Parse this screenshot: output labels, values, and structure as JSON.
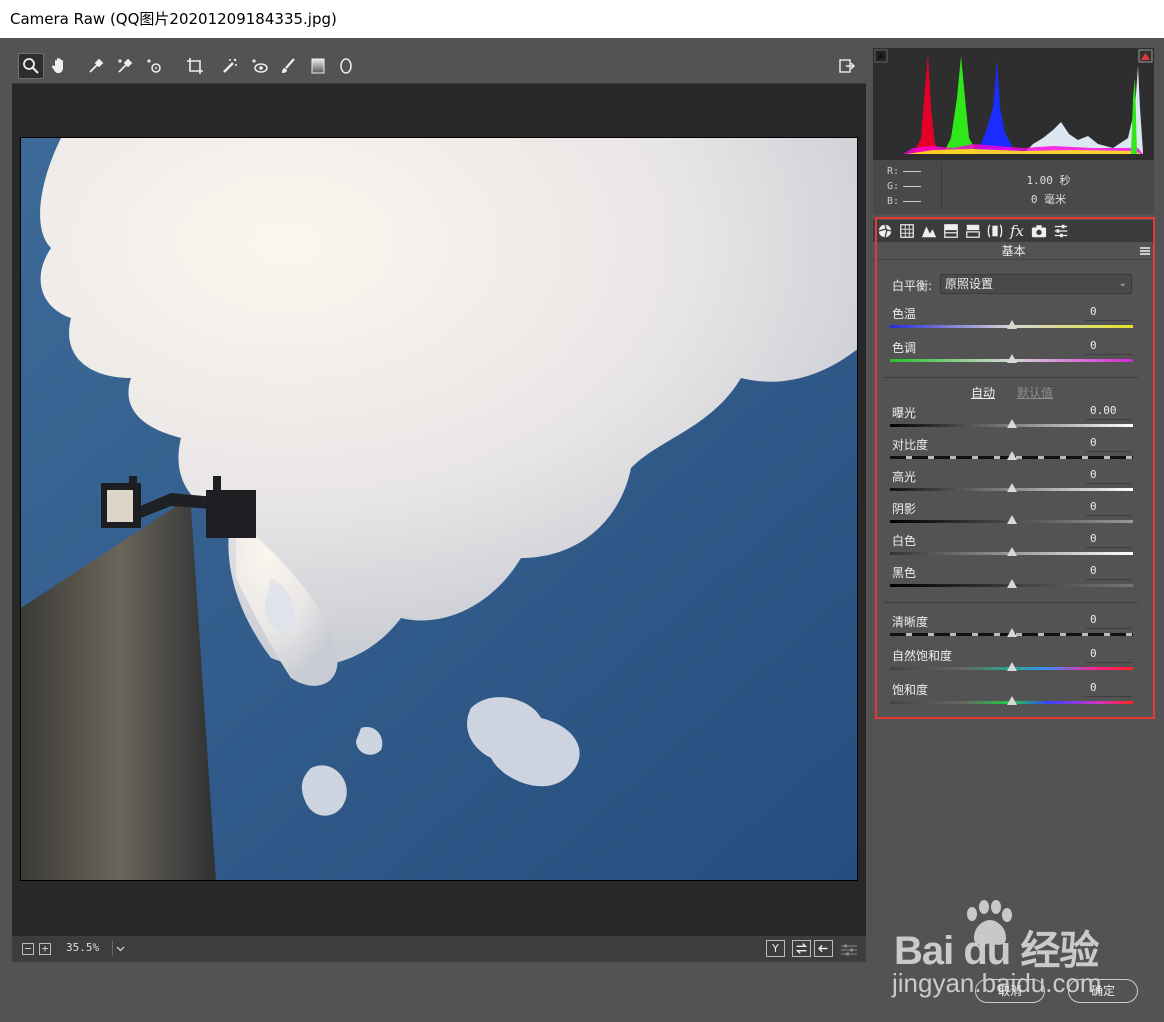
{
  "window": {
    "title": "Camera Raw (QQ图片20201209184335.jpg)"
  },
  "toolbar": {
    "tools": [
      "zoom-icon",
      "hand-icon",
      "eyedropper-icon",
      "color-sampler-icon",
      "targeted-adjust-icon",
      "crop-icon",
      "spot-removal-icon",
      "red-eye-icon",
      "adjustment-brush-icon",
      "graduated-filter-icon",
      "radial-filter-icon"
    ]
  },
  "status": {
    "zoom": "35.5%",
    "minus": "−",
    "plus": "+",
    "compare_label": "Y"
  },
  "histogram": {
    "r_label": "R:",
    "g_label": "G:",
    "b_label": "B:",
    "shutter": "1.00 秒",
    "focal": "0 毫米"
  },
  "panel": {
    "title": "基本",
    "white_balance_label": "白平衡:",
    "white_balance_value": "原照设置",
    "auto_label": "自动",
    "default_label": "默认值",
    "sliders": [
      {
        "label": "色温",
        "value": "0",
        "position": 0.5
      },
      {
        "label": "色调",
        "value": "0",
        "position": 0.5
      },
      {
        "label": "曝光",
        "value": "0.00",
        "position": 0.5
      },
      {
        "label": "对比度",
        "value": "0",
        "position": 0.5
      },
      {
        "label": "高光",
        "value": "0",
        "position": 0.5
      },
      {
        "label": "阴影",
        "value": "0",
        "position": 0.5
      },
      {
        "label": "白色",
        "value": "0",
        "position": 0.5
      },
      {
        "label": "黑色",
        "value": "0",
        "position": 0.5
      },
      {
        "label": "清晰度",
        "value": "0",
        "position": 0.5
      },
      {
        "label": "自然饱和度",
        "value": "0",
        "position": 0.5
      },
      {
        "label": "饱和度",
        "value": "0",
        "position": 0.5
      }
    ]
  },
  "buttons": {
    "cancel": "取消",
    "ok": "确定"
  },
  "watermark": {
    "brand": "Bai du 经验",
    "url": "jingyan.baidu.com"
  },
  "colors": {
    "highlight_box": "#e53935",
    "panel_bg": "#535353",
    "preview_bg": "#282828"
  }
}
